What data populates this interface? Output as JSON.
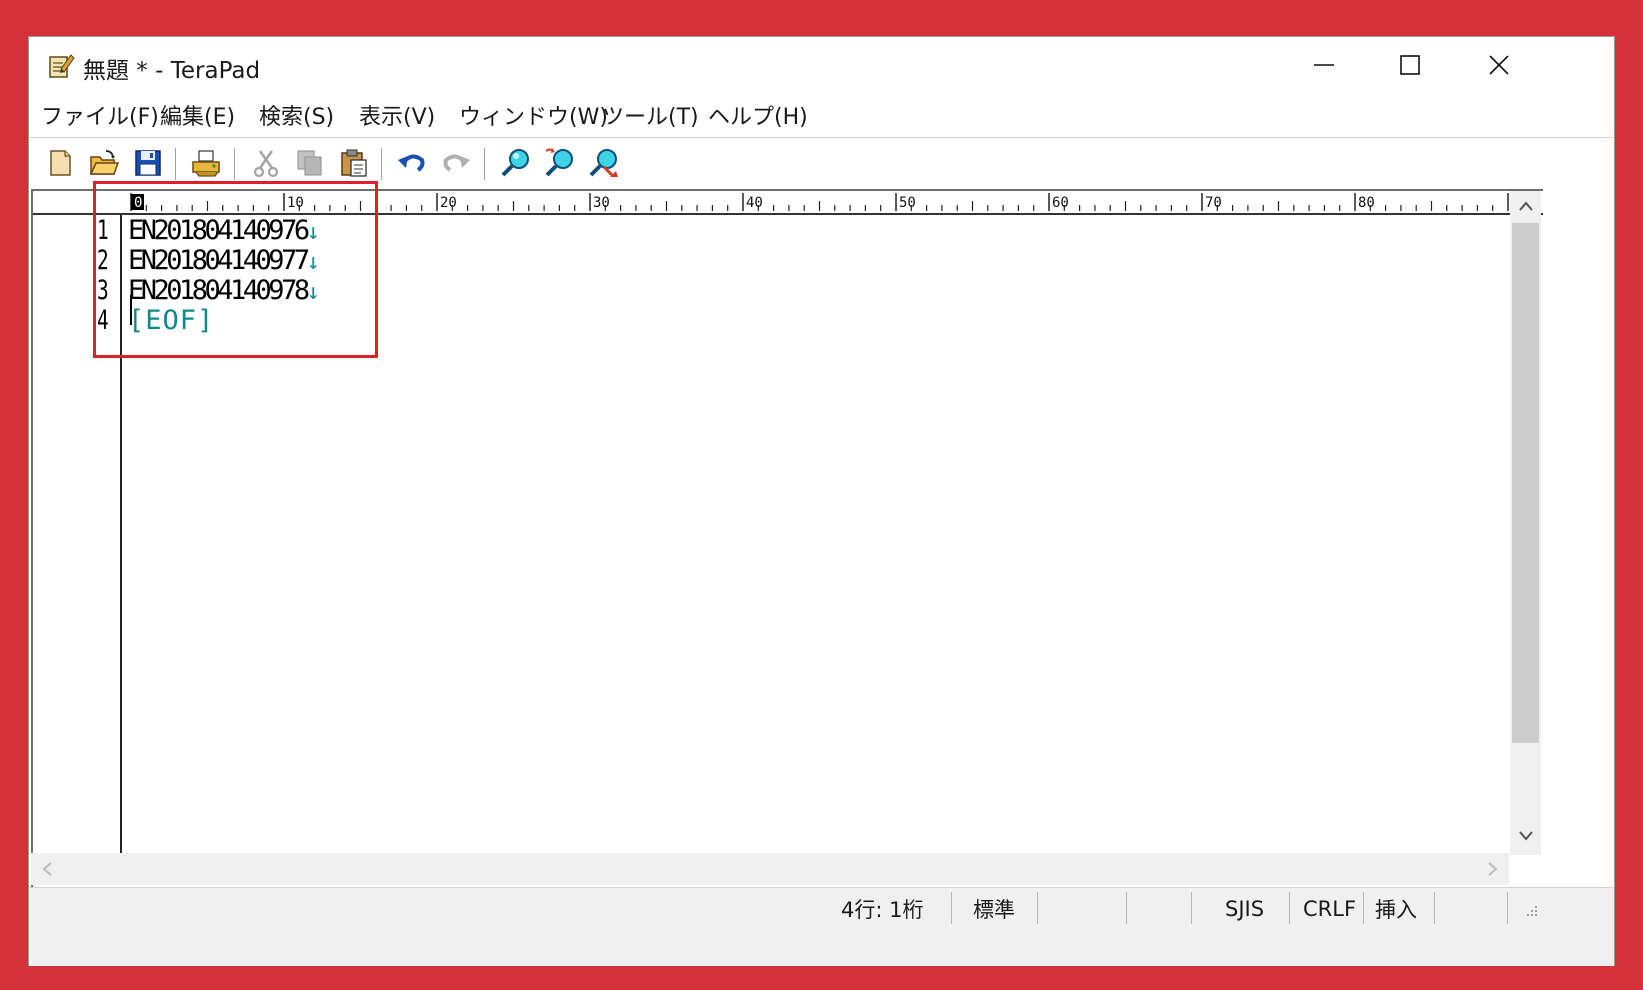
{
  "window": {
    "title": "無題 * - TeraPad",
    "app_icon": "notepad-pencil-icon"
  },
  "window_controls": {
    "minimize_icon": "minimize-icon",
    "maximize_icon": "maximize-icon",
    "close_icon": "close-icon"
  },
  "menu": {
    "items": [
      {
        "label": "ファイル(F)"
      },
      {
        "label": "編集(E)"
      },
      {
        "label": "検索(S)"
      },
      {
        "label": "表示(V)"
      },
      {
        "label": "ウィンドウ(W)"
      },
      {
        "label": "ツール(T)"
      },
      {
        "label": "ヘルプ(H)"
      }
    ]
  },
  "toolbar": {
    "buttons": [
      {
        "icon": "new-file-icon",
        "enabled": true
      },
      {
        "icon": "open-folder-icon",
        "enabled": true
      },
      {
        "icon": "save-icon",
        "enabled": true
      },
      {
        "icon": "print-icon",
        "enabled": true
      },
      {
        "icon": "cut-icon",
        "enabled": false
      },
      {
        "icon": "copy-icon",
        "enabled": false
      },
      {
        "icon": "paste-icon",
        "enabled": true
      },
      {
        "icon": "undo-icon",
        "enabled": true
      },
      {
        "icon": "redo-icon",
        "enabled": false
      },
      {
        "icon": "find-icon",
        "enabled": true
      },
      {
        "icon": "find-next-icon",
        "enabled": true
      },
      {
        "icon": "replace-icon",
        "enabled": true
      }
    ]
  },
  "ruler": {
    "labels": [
      "0",
      "10",
      "20",
      "30",
      "40",
      "50",
      "60",
      "70",
      "80"
    ]
  },
  "editor": {
    "lines": [
      {
        "number": "1",
        "text": "EN201804140976",
        "eol": "↓"
      },
      {
        "number": "2",
        "text": "EN201804140977",
        "eol": "↓"
      },
      {
        "number": "3",
        "text": "EN201804140978",
        "eol": "↓"
      },
      {
        "number": "4",
        "text": "",
        "eol": "[EOF]"
      }
    ],
    "eol_color": "#0f8a8a",
    "highlight_color": "#e01f2a"
  },
  "status": {
    "position": "4行:  1桁",
    "mode": "標準",
    "encoding": "SJIS",
    "line_ending": "CRLF",
    "insert_mode": "挿入"
  },
  "colors": {
    "background": "#d4323a"
  }
}
